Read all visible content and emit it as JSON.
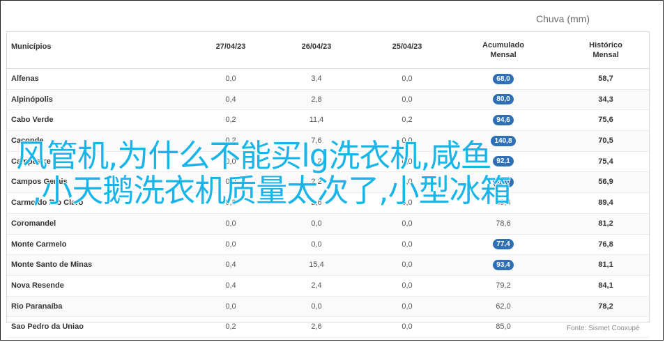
{
  "unit_label": "Chuva (mm)",
  "headers": {
    "municipio": "Municípios",
    "d1": "27/04/23",
    "d2": "26/04/23",
    "d3": "25/04/23",
    "acumulado": "Acumulado\nMensal",
    "historico": "Histórico\nMensal"
  },
  "rows": [
    {
      "name": "Alfenas",
      "d1": "0,0",
      "d2": "3,4",
      "d3": "0,0",
      "acc": "68,0",
      "hist": "58,7",
      "hl": true
    },
    {
      "name": "Alpinópolis",
      "d1": "0,4",
      "d2": "2,8",
      "d3": "0,0",
      "acc": "80,0",
      "hist": "34,3",
      "hl": true
    },
    {
      "name": "Cabo Verde",
      "d1": "0,2",
      "d2": "11,4",
      "d3": "0,2",
      "acc": "94,6",
      "hist": "75,6",
      "hl": true
    },
    {
      "name": "Caconde",
      "d1": "0,2",
      "d2": "7,6",
      "d3": "0,0",
      "acc": "140,8",
      "hist": "70,5",
      "hl": true
    },
    {
      "name": "Campestre",
      "d1": "0,0",
      "d2": "4,2",
      "d3": "0,0",
      "acc": "92,1",
      "hist": "75,4",
      "hl": true
    },
    {
      "name": "Campos Gerais",
      "d1": "0,0",
      "d2": "2,2",
      "d3": "0,0",
      "acc": "85,0",
      "hist": "56,9",
      "hl": true
    },
    {
      "name": "Carmo do Rio Claro",
      "d1": "0,0",
      "d2": "2,6",
      "d3": "0,0",
      "acc": "89,4",
      "hist": "89,4",
      "hl": false
    },
    {
      "name": "Coromandel",
      "d1": "0,0",
      "d2": "0,0",
      "d3": "0,0",
      "acc": "78,6",
      "hist": "81,2",
      "hl": false
    },
    {
      "name": "Monte Carmelo",
      "d1": "0,0",
      "d2": "0,0",
      "d3": "0,0",
      "acc": "77,4",
      "hist": "76,8",
      "hl": true
    },
    {
      "name": "Monte Santo de Minas",
      "d1": "0,4",
      "d2": "15,4",
      "d3": "0,0",
      "acc": "93,4",
      "hist": "81,1",
      "hl": true
    },
    {
      "name": "Nova Resende",
      "d1": "0,4",
      "d2": "2,4",
      "d3": "0,0",
      "acc": "79,2",
      "hist": "84,1",
      "hl": false
    },
    {
      "name": "Rio Paranaíba",
      "d1": "0,0",
      "d2": "0,0",
      "d3": "0,0",
      "acc": "62,0",
      "hist": "78,2",
      "hl": false
    },
    {
      "name": "Sao Pedro da Uniao",
      "d1": "0,2",
      "d2": "2,6",
      "d3": "0,0",
      "acc": "85,0",
      "hist": "",
      "hl": false
    }
  ],
  "source": "Fonte: Sismet Cooxupé",
  "overlay": {
    "line1": "风管机,为什么不能买lg洗衣机,咸鱼",
    "line2": ",小天鹅洗衣机质量太次了,小型冰箱"
  },
  "colors": {
    "pill": "#2e6fb5",
    "overlay": "#19b5e8"
  }
}
